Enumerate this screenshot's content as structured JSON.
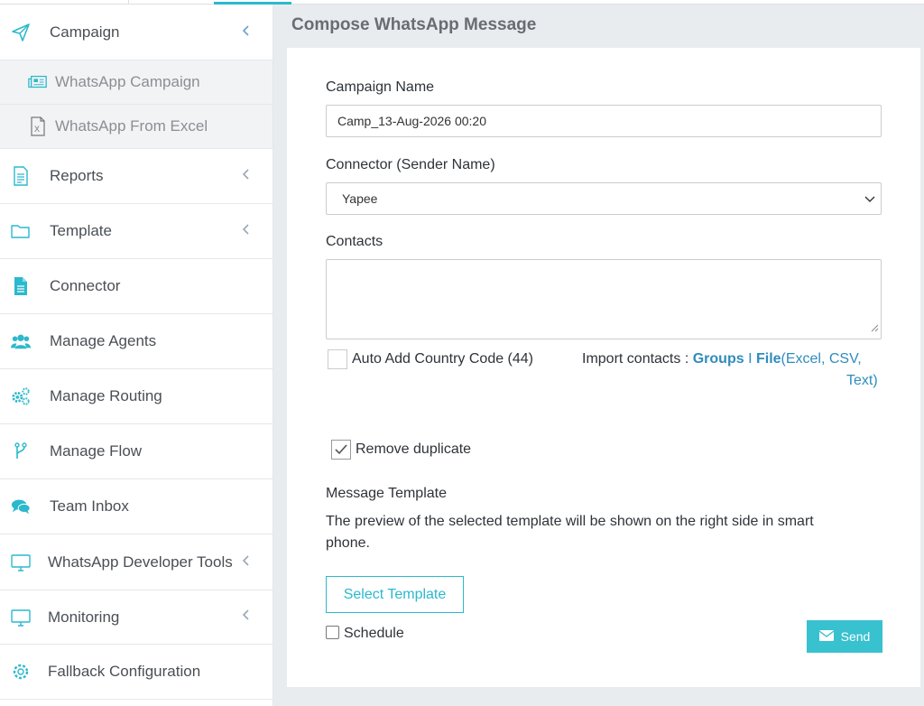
{
  "sidebar": {
    "campaign": {
      "label": "Campaign",
      "icon": "paper-plane-icon"
    },
    "sub_items": [
      {
        "label": "WhatsApp Campaign",
        "icon": "newspaper-icon"
      },
      {
        "label": "WhatsApp From Excel",
        "icon": "excel-file-icon"
      }
    ],
    "items": [
      {
        "label": "Reports",
        "icon": "report-icon",
        "has_chevron": true
      },
      {
        "label": "Template",
        "icon": "folder-icon",
        "has_chevron": true
      },
      {
        "label": "Connector",
        "icon": "file-icon",
        "has_chevron": false
      },
      {
        "label": "Manage Agents",
        "icon": "users-icon",
        "has_chevron": false
      },
      {
        "label": "Manage Routing",
        "icon": "cogs-icon",
        "has_chevron": false
      },
      {
        "label": "Manage Flow",
        "icon": "branch-icon",
        "has_chevron": false
      },
      {
        "label": "Team Inbox",
        "icon": "chat-icon",
        "has_chevron": false
      },
      {
        "label": "WhatsApp Developer Tools",
        "icon": "monitor-icon",
        "has_chevron": true
      },
      {
        "label": "Monitoring",
        "icon": "monitor-icon",
        "has_chevron": true
      },
      {
        "label": "Fallback Configuration",
        "icon": "gear-icon",
        "has_chevron": false
      }
    ]
  },
  "main": {
    "title": "Compose WhatsApp Message",
    "campaign_name": {
      "label": "Campaign Name",
      "value": "Camp_13-Aug-2026 00:20"
    },
    "connector": {
      "label": "Connector (Sender Name)",
      "value": "Yapee"
    },
    "contacts": {
      "label": "Contacts",
      "value": ""
    },
    "auto_add_country_code": {
      "label": "Auto Add Country Code (44)",
      "checked": false
    },
    "import_contacts": {
      "prefix": "Import contacts : ",
      "groups": "Groups",
      "separator": "I",
      "file": "File",
      "file_types_line1": "(Excel, CSV,",
      "file_types_line2": "Text)"
    },
    "remove_duplicate": {
      "label": "Remove duplicate",
      "checked": true
    },
    "message_template": {
      "label": "Message Template",
      "description_line1": "The preview of the selected template will be shown on the right side in smart",
      "description_line2": "phone."
    },
    "select_template_label": "Select Template",
    "schedule": {
      "label": "Schedule",
      "checked": false
    },
    "send_label": "Send"
  },
  "colors": {
    "accent": "#2bb9cd",
    "link": "#2f8cbc",
    "send_button": "#38c1cf",
    "icon": "#2bb9cd"
  }
}
